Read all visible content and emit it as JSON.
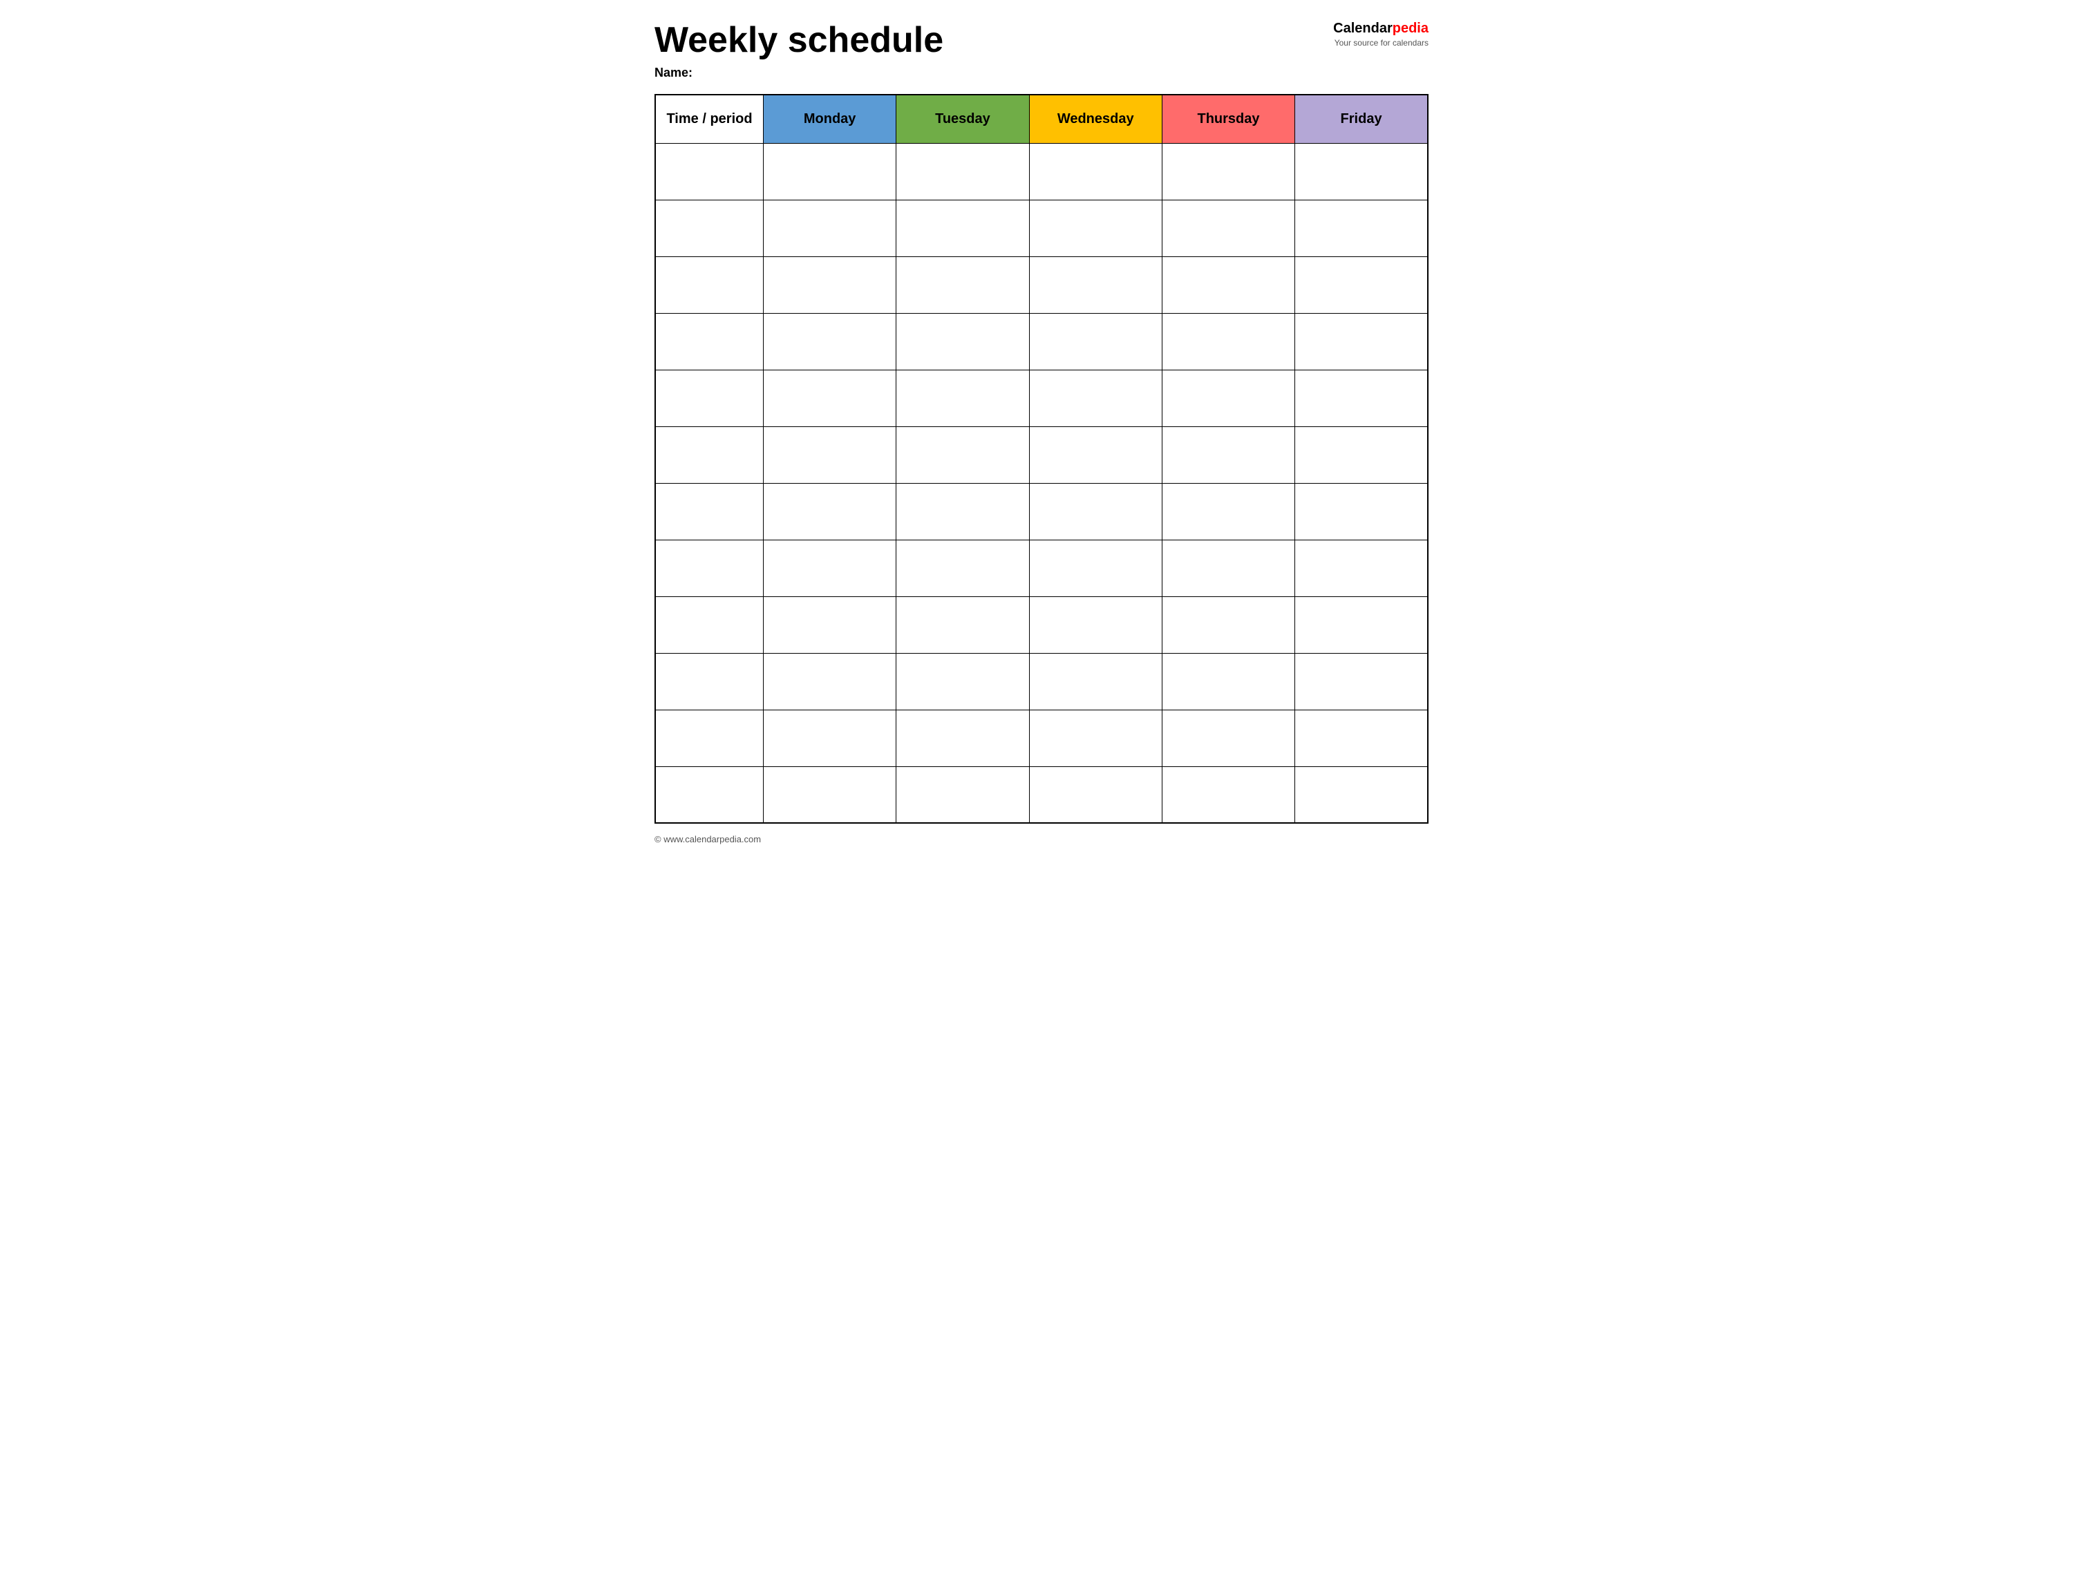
{
  "header": {
    "title": "Weekly schedule",
    "name_label": "Name:",
    "logo_calendar": "Calendar",
    "logo_pedia": "pedia",
    "logo_tagline": "Your source for calendars"
  },
  "table": {
    "columns": [
      {
        "id": "time",
        "label": "Time / period",
        "color": "#ffffff",
        "class": "th-time"
      },
      {
        "id": "monday",
        "label": "Monday",
        "color": "#5b9bd5",
        "class": "th-monday"
      },
      {
        "id": "tuesday",
        "label": "Tuesday",
        "color": "#70ad47",
        "class": "th-tuesday"
      },
      {
        "id": "wednesday",
        "label": "Wednesday",
        "color": "#ffc000",
        "class": "th-wednesday"
      },
      {
        "id": "thursday",
        "label": "Thursday",
        "color": "#ff6b6b",
        "class": "th-thursday"
      },
      {
        "id": "friday",
        "label": "Friday",
        "color": "#b4a7d6",
        "class": "th-friday"
      }
    ],
    "row_count": 12
  },
  "footer": {
    "text": "© www.calendarpedia.com"
  }
}
